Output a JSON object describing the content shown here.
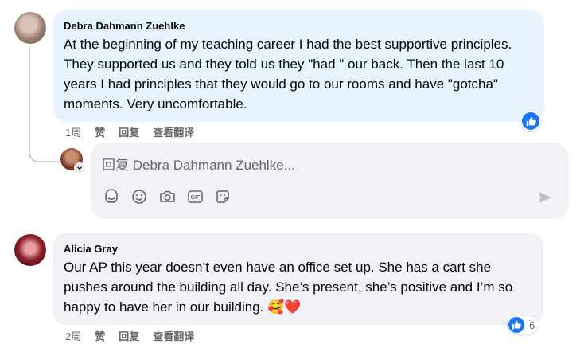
{
  "comments": [
    {
      "author": "Debra Dahmann Zuehlke",
      "text": "At the beginning of my teaching career I had the best supportive principles. They supported us and they told us they \"had \" our back. Then the last 10 years I had principles that they would go to our rooms and have \"gotcha\" moments. Very uncomfortable.",
      "time": "1周",
      "like_label": "赞",
      "reply_label": "回复",
      "translate_label": "查看翻译"
    },
    {
      "author": "Alicia Gray",
      "text": "Our AP this year doesn’t even have an office set up. She has a cart she pushes around the building all day. She’s present, she’s positive and I’m so happy to have her in our building.",
      "emoji": "🥰❤️",
      "time": "2周",
      "like_label": "赞",
      "reply_label": "回复",
      "translate_label": "查看翻译",
      "reaction_count": "6"
    }
  ],
  "reply_box": {
    "placeholder": "回复 Debra Dahmann Zuehlke..."
  },
  "icons": [
    "like-icon",
    "sticker-icon",
    "emoji-icon",
    "camera-icon",
    "gif-icon",
    "avatar-sticker-icon",
    "send-icon",
    "chevron-down-icon"
  ],
  "colors": {
    "accent": "#1877f2",
    "bubble_blue": "#e7f3ff",
    "bubble_gray": "#f0f2f5",
    "meta": "#65676b"
  }
}
